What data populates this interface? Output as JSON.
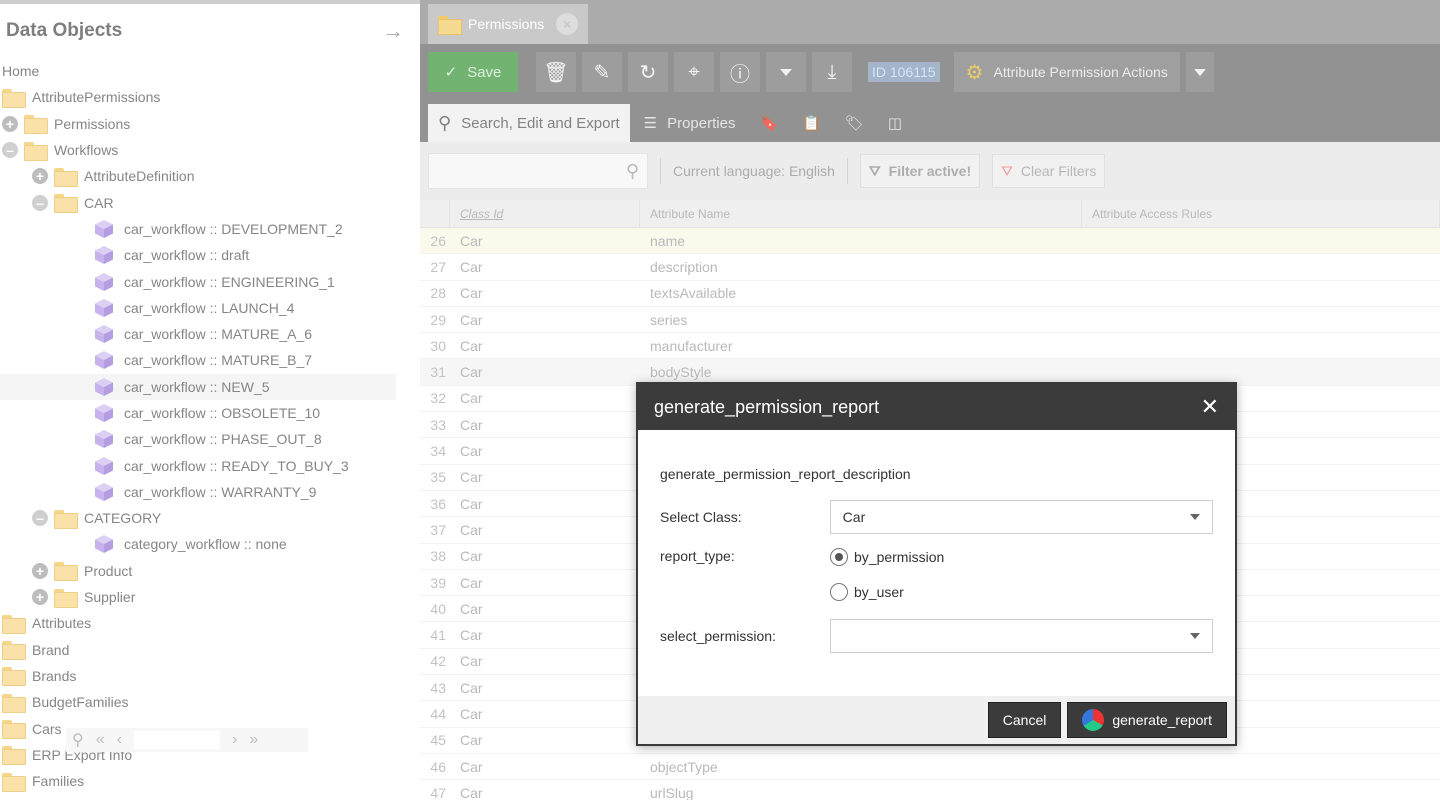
{
  "left_panel": {
    "title": "Data Objects",
    "tree": [
      {
        "label": "Home",
        "level": 0,
        "icon": "none"
      },
      {
        "label": "AttributePermissions",
        "level": 0,
        "icon": "folder"
      },
      {
        "label": "Permissions",
        "level": 1,
        "icon": "folder",
        "toggle": "plus"
      },
      {
        "label": "Workflows",
        "level": 1,
        "icon": "folder",
        "toggle": "minus"
      },
      {
        "label": "AttributeDefinition",
        "level": 2,
        "icon": "folder",
        "toggle": "plus"
      },
      {
        "label": "CAR",
        "level": 2,
        "icon": "folder",
        "toggle": "minus"
      },
      {
        "label": "car_workflow :: DEVELOPMENT_2",
        "level": 3,
        "icon": "cube"
      },
      {
        "label": "car_workflow :: draft",
        "level": 3,
        "icon": "cube"
      },
      {
        "label": "car_workflow :: ENGINEERING_1",
        "level": 3,
        "icon": "cube"
      },
      {
        "label": "car_workflow :: LAUNCH_4",
        "level": 3,
        "icon": "cube"
      },
      {
        "label": "car_workflow :: MATURE_A_6",
        "level": 3,
        "icon": "cube"
      },
      {
        "label": "car_workflow :: MATURE_B_7",
        "level": 3,
        "icon": "cube"
      },
      {
        "label": "car_workflow :: NEW_5",
        "level": 3,
        "icon": "cube",
        "selected": true
      },
      {
        "label": "car_workflow :: OBSOLETE_10",
        "level": 3,
        "icon": "cube"
      },
      {
        "label": "car_workflow :: PHASE_OUT_8",
        "level": 3,
        "icon": "cube"
      },
      {
        "label": "car_workflow :: READY_TO_BUY_3",
        "level": 3,
        "icon": "cube"
      },
      {
        "label": "car_workflow :: WARRANTY_9",
        "level": 3,
        "icon": "cube"
      },
      {
        "label": "CATEGORY",
        "level": 2,
        "icon": "folder",
        "toggle": "minus"
      },
      {
        "label": "category_workflow :: none",
        "level": 3,
        "icon": "cube"
      },
      {
        "label": "Product",
        "level": 2,
        "icon": "folder",
        "toggle": "plus"
      },
      {
        "label": "Supplier",
        "level": 2,
        "icon": "folder",
        "toggle": "plus"
      },
      {
        "label": "Attributes",
        "level": 0,
        "icon": "folder"
      },
      {
        "label": "Brand",
        "level": 0,
        "icon": "folder"
      },
      {
        "label": "Brands",
        "level": 0,
        "icon": "folder"
      },
      {
        "label": "BudgetFamilies",
        "level": 0,
        "icon": "folder"
      },
      {
        "label": "Cars",
        "level": 0,
        "icon": "folder"
      },
      {
        "label": "ERP Export Info",
        "level": 0,
        "icon": "folder"
      },
      {
        "label": "Families",
        "level": 0,
        "icon": "folder"
      }
    ]
  },
  "tab": {
    "label": "Permissions"
  },
  "toolbar": {
    "save_label": "Save",
    "id_label": "ID 106115",
    "actions_label": "Attribute Permission Actions"
  },
  "subtabs": {
    "search": "Search, Edit and Export",
    "properties": "Properties"
  },
  "filters": {
    "language": "Current language: English",
    "filter_active": "Filter active!",
    "clear_filters": "Clear Filters"
  },
  "grid": {
    "headers": {
      "class_id": "Class Id",
      "attribute_name": "Attribute Name",
      "rules": "Attribute Access Rules"
    },
    "rows": [
      {
        "n": "26",
        "cls": "Car",
        "attr": "name"
      },
      {
        "n": "27",
        "cls": "Car",
        "attr": "description"
      },
      {
        "n": "28",
        "cls": "Car",
        "attr": "textsAvailable"
      },
      {
        "n": "29",
        "cls": "Car",
        "attr": "series"
      },
      {
        "n": "30",
        "cls": "Car",
        "attr": "manufacturer"
      },
      {
        "n": "31",
        "cls": "Car",
        "attr": "bodyStyle"
      },
      {
        "n": "32",
        "cls": "Car",
        "attr": ""
      },
      {
        "n": "33",
        "cls": "Car",
        "attr": ""
      },
      {
        "n": "34",
        "cls": "Car",
        "attr": ""
      },
      {
        "n": "35",
        "cls": "Car",
        "attr": ""
      },
      {
        "n": "36",
        "cls": "Car",
        "attr": ""
      },
      {
        "n": "37",
        "cls": "Car",
        "attr": ""
      },
      {
        "n": "38",
        "cls": "Car",
        "attr": ""
      },
      {
        "n": "39",
        "cls": "Car",
        "attr": ""
      },
      {
        "n": "40",
        "cls": "Car",
        "attr": ""
      },
      {
        "n": "41",
        "cls": "Car",
        "attr": ""
      },
      {
        "n": "42",
        "cls": "Car",
        "attr": ""
      },
      {
        "n": "43",
        "cls": "Car",
        "attr": ""
      },
      {
        "n": "44",
        "cls": "Car",
        "attr": ""
      },
      {
        "n": "45",
        "cls": "Car",
        "attr": ""
      },
      {
        "n": "46",
        "cls": "Car",
        "attr": "objectType"
      },
      {
        "n": "47",
        "cls": "Car",
        "attr": "urlSlug"
      }
    ]
  },
  "modal": {
    "title": "generate_permission_report",
    "description": "generate_permission_report_description",
    "select_class_label": "Select Class:",
    "select_class_value": "Car",
    "report_type_label": "report_type:",
    "option_by_permission": "by_permission",
    "option_by_user": "by_user",
    "select_permission_label": "select_permission:",
    "select_permission_value": "",
    "cancel_label": "Cancel",
    "generate_label": "generate_report"
  }
}
